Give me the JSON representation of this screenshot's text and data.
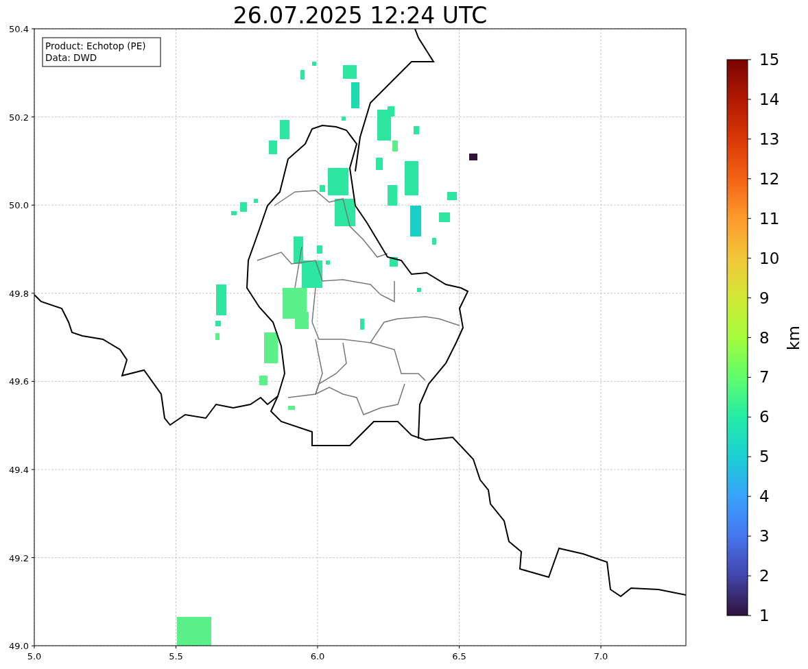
{
  "title": "26.07.2025 12:24 UTC",
  "info_box": [
    "Product: Echotop (PE)",
    "Data: DWD"
  ],
  "map": {
    "x_ticks": [
      "5.0",
      "5.5",
      "6.0",
      "6.5",
      "7.0"
    ],
    "y_ticks": [
      "50.4",
      "50.2",
      "50.0",
      "49.8",
      "49.6",
      "49.4",
      "49.2",
      "49.0"
    ]
  },
  "colorbar": {
    "label": "km",
    "ticks": [
      "15",
      "14",
      "13",
      "12",
      "11",
      "10",
      "9",
      "8",
      "7",
      "6",
      "5",
      "4",
      "3",
      "2",
      "1"
    ]
  }
}
